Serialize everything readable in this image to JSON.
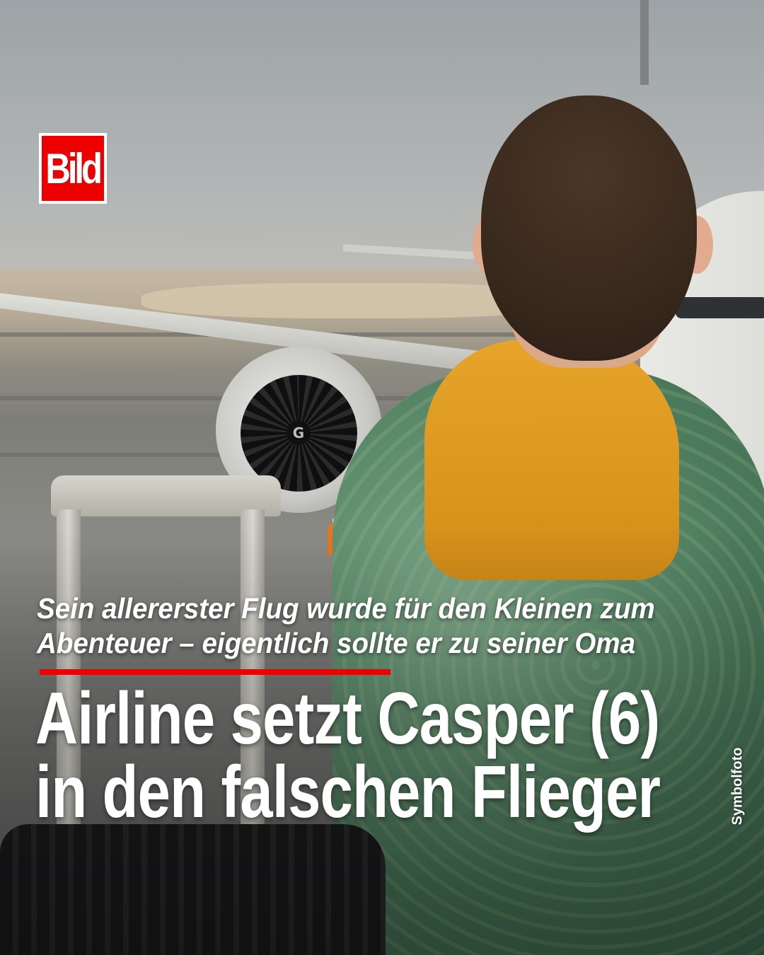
{
  "brand": {
    "logo_text": "Bild",
    "logo_color": "#e00000"
  },
  "article": {
    "kicker_line1": "Sein allererster Flug wurde für den Kleinen zum",
    "kicker_line2": "Abenteuer – eigentlich sollte er zu seiner Oma",
    "headline_line1": "Airline setzt Casper (6)",
    "headline_line2": "in den falschen Flieger",
    "photo_credit": "Symbolfoto",
    "accent_color": "#e00000"
  },
  "photo": {
    "description_icons": [
      "airplane",
      "child",
      "suitcase"
    ],
    "engine_mark": "G"
  }
}
